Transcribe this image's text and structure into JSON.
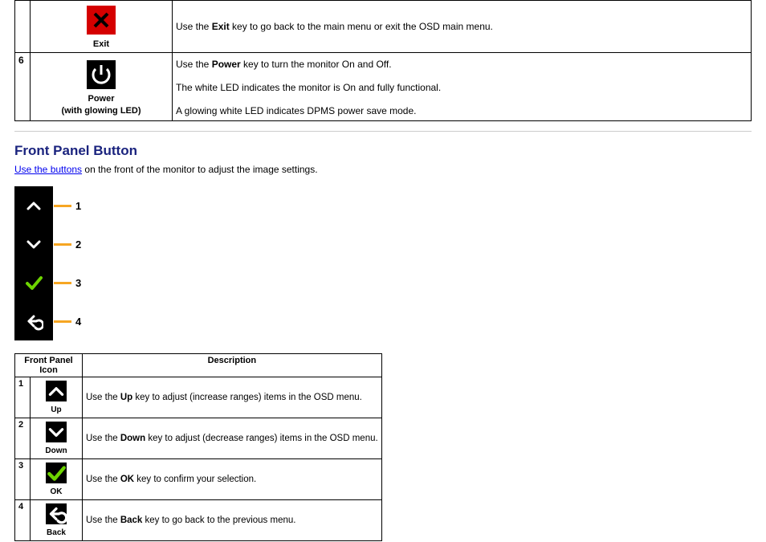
{
  "top_rows": [
    {
      "num": "",
      "icon": "exit",
      "label": "Exit",
      "sublabel": "",
      "desc_html": "Use the <b>Exit</b> key to go back to the main menu or exit the OSD main menu."
    },
    {
      "num": "6",
      "icon": "power",
      "label": "Power",
      "sublabel": "(with glowing LED)",
      "desc_html": "<p>Use the <b>Power</b> key to turn the monitor On and Off.</p><p>The white LED indicates the monitor is On and fully functional.</p><p style='margin-bottom:2px;'>A glowing white LED indicates DPMS power save mode.</p>"
    }
  ],
  "section_title": "Front Panel Button",
  "link_text": "Use the buttons",
  "intro_rest": " on the front of the monitor to adjust the image settings.",
  "panel_buttons": [
    {
      "icon": "up",
      "num": "1"
    },
    {
      "icon": "down",
      "num": "2"
    },
    {
      "icon": "ok",
      "num": "3"
    },
    {
      "icon": "back",
      "num": "4"
    }
  ],
  "small_headers": {
    "c1": "Front Panel Icon",
    "c2": "Description"
  },
  "small_rows": [
    {
      "num": "1",
      "icon": "up",
      "label": "Up",
      "desc_html": "Use the <b>Up</b> key to adjust (increase ranges) items in the OSD menu."
    },
    {
      "num": "2",
      "icon": "down",
      "label": "Down",
      "desc_html": "Use the <b>Down</b> key to adjust (decrease ranges) items in the OSD menu."
    },
    {
      "num": "3",
      "icon": "ok",
      "label": "OK",
      "desc_html": "Use the <b>OK</b> key to confirm your selection."
    },
    {
      "num": "4",
      "icon": "back",
      "label": "Back",
      "desc_html": "Use the <b>Back</b> key to go back to the previous menu."
    }
  ]
}
